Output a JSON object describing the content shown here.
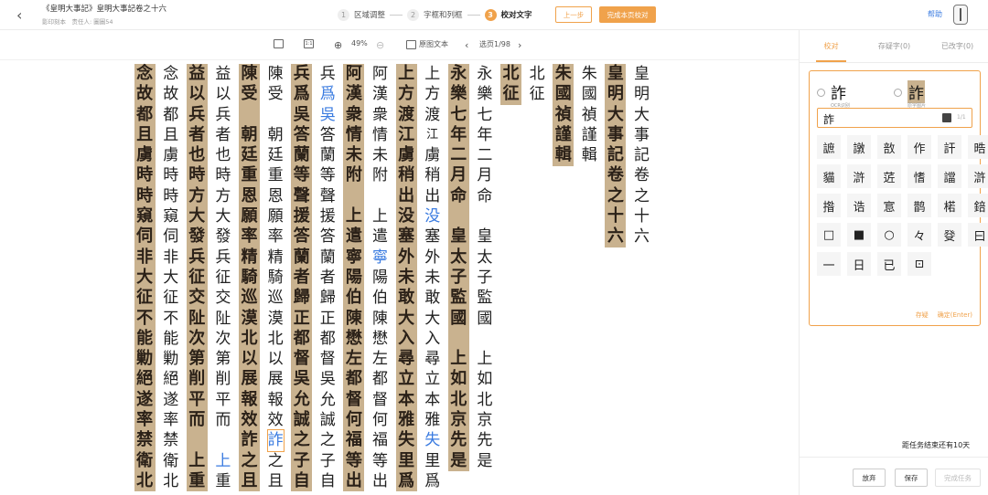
{
  "header": {
    "title": "《皇明大事記》皇明大事記卷之十六",
    "subtitle": "影印刻本　责任人: 圖圖54",
    "steps": [
      {
        "num": "1",
        "label": "区域调整"
      },
      {
        "num": "2",
        "label": "字框和列框"
      },
      {
        "num": "3",
        "label": "校对文字"
      }
    ],
    "prev_button": "上一步",
    "complete_page_button": "完成本页校对",
    "help": "帮助"
  },
  "toolbar": {
    "zoom": "49%",
    "original_text": "原图文本",
    "page": "选页1/98"
  },
  "document": {
    "columns": [
      {
        "kind": "text",
        "chars": [
          "皇",
          "明",
          "大",
          "事",
          "記",
          "卷",
          "之",
          "十",
          "六"
        ]
      },
      {
        "kind": "image",
        "chars": [
          "皇",
          "明",
          "大",
          "事",
          "記",
          "卷",
          "之",
          "十",
          "六"
        ]
      },
      {
        "kind": "text",
        "chars": [
          "朱",
          "國",
          "禎",
          "謹",
          "輯"
        ]
      },
      {
        "kind": "image",
        "chars": [
          "朱",
          "國",
          "禎",
          "謹",
          "輯"
        ]
      },
      {
        "kind": "text",
        "chars": [
          "北",
          "征"
        ]
      },
      {
        "kind": "image",
        "chars": [
          "北",
          "征"
        ]
      },
      {
        "kind": "text",
        "chars": [
          "永",
          "樂",
          "七",
          "年",
          "二",
          "月",
          "命",
          "　",
          "皇",
          "太",
          "子",
          "監",
          "國",
          "　",
          "上",
          "如",
          "北",
          "京",
          "先",
          "是"
        ]
      },
      {
        "kind": "image",
        "chars": [
          "永",
          "樂",
          "七",
          "年",
          "二",
          "月",
          "命",
          "　",
          "皇",
          "太",
          "子",
          "監",
          "國",
          "　",
          "上",
          "如",
          "北",
          "京",
          "先",
          "是"
        ]
      },
      {
        "kind": "text",
        "chars": [
          "上",
          "方",
          "渡",
          "江",
          "虜",
          "稍",
          "出",
          "没",
          "塞",
          "外",
          "未",
          "敢",
          "大",
          "入",
          "尋",
          "立",
          "本",
          "雅",
          "失",
          "里",
          "爲"
        ]
      },
      {
        "kind": "image",
        "chars": [
          "上",
          "方",
          "渡",
          "江",
          "虜",
          "稍",
          "出",
          "没",
          "塞",
          "外",
          "未",
          "敢",
          "大",
          "入",
          "尋",
          "立",
          "本",
          "雅",
          "失",
          "里",
          "爲"
        ]
      },
      {
        "kind": "text",
        "chars": [
          "阿",
          "漢",
          "衆",
          "情",
          "未",
          "附",
          "　",
          "上",
          "遣",
          "寧",
          "陽",
          "伯",
          "陳",
          "懋",
          "左",
          "都",
          "督",
          "何",
          "福",
          "等",
          "出"
        ]
      },
      {
        "kind": "image",
        "chars": [
          "阿",
          "漢",
          "衆",
          "情",
          "未",
          "附",
          "　",
          "上",
          "遣",
          "寧",
          "陽",
          "伯",
          "陳",
          "懋",
          "左",
          "都",
          "督",
          "何",
          "福",
          "等",
          "出"
        ]
      },
      {
        "kind": "text",
        "chars": [
          "兵",
          "爲",
          "吳",
          "答",
          "蘭",
          "等",
          "聲",
          "援",
          "答",
          "蘭",
          "者",
          "歸",
          "正",
          "都",
          "督",
          "吳",
          "允",
          "誠",
          "之",
          "子",
          "自"
        ]
      },
      {
        "kind": "image",
        "chars": [
          "兵",
          "爲",
          "吳",
          "答",
          "蘭",
          "等",
          "聲",
          "援",
          "答",
          "蘭",
          "者",
          "歸",
          "正",
          "都",
          "督",
          "吳",
          "允",
          "誠",
          "之",
          "子",
          "自"
        ]
      },
      {
        "kind": "text",
        "chars": [
          "陳",
          "受",
          "　",
          "朝",
          "廷",
          "重",
          "恩",
          "願",
          "率",
          "精",
          "騎",
          "巡",
          "漠",
          "北",
          "以",
          "展",
          "報",
          "效",
          "詐",
          "之",
          "且"
        ]
      },
      {
        "kind": "image",
        "chars": [
          "陳",
          "受",
          "　",
          "朝",
          "廷",
          "重",
          "恩",
          "願",
          "率",
          "精",
          "騎",
          "巡",
          "漠",
          "北",
          "以",
          "展",
          "報",
          "效",
          "詐",
          "之",
          "且"
        ]
      },
      {
        "kind": "text",
        "chars": [
          "益",
          "以",
          "兵",
          "者",
          "也",
          "時",
          "方",
          "大",
          "發",
          "兵",
          "征",
          "交",
          "阯",
          "次",
          "第",
          "削",
          "平",
          "而",
          "　",
          "上",
          "重"
        ]
      },
      {
        "kind": "image",
        "chars": [
          "益",
          "以",
          "兵",
          "者",
          "也",
          "時",
          "方",
          "大",
          "發",
          "兵",
          "征",
          "交",
          "阯",
          "次",
          "第",
          "削",
          "平",
          "而",
          "　",
          "上",
          "重"
        ]
      },
      {
        "kind": "text",
        "chars": [
          "念",
          "故",
          "都",
          "且",
          "虜",
          "時",
          "時",
          "窺",
          "伺",
          "非",
          "大",
          "征",
          "不",
          "能",
          "勦",
          "絕",
          "遂",
          "率",
          "禁",
          "衛",
          "北"
        ]
      },
      {
        "kind": "image",
        "chars": [
          "念",
          "故",
          "都",
          "且",
          "虜",
          "時",
          "時",
          "窺",
          "伺",
          "非",
          "大",
          "征",
          "不",
          "能",
          "勦",
          "絕",
          "遂",
          "率",
          "禁",
          "衛",
          "北"
        ]
      }
    ]
  },
  "panel": {
    "tabs": [
      "校对",
      "存疑字(0)",
      "已改字(0)"
    ],
    "candidate_ocr": {
      "char": "詐",
      "label": "OCR识别"
    },
    "candidate_img": {
      "char": "詐",
      "label": "原字图片"
    },
    "input_value": "詐",
    "input_count": "1/1",
    "grid_chars": [
      "謶",
      "譈",
      "敨",
      "作",
      "訐",
      "晧",
      "貓",
      "滸",
      "菦",
      "愭",
      "譡",
      "滸",
      "揝",
      "诰",
      "悹",
      "鹊",
      "楉",
      "錇",
      "□",
      "■",
      "○",
      "々",
      "癹",
      "曰",
      "一",
      "日",
      "已",
      "⊡"
    ],
    "doubt_action": "存疑",
    "confirm_action": "确定(Enter)",
    "remaining": "距任务结束还有10天",
    "buttons": {
      "abandon": "放弃",
      "save": "保存",
      "finish": "完成任务"
    }
  }
}
